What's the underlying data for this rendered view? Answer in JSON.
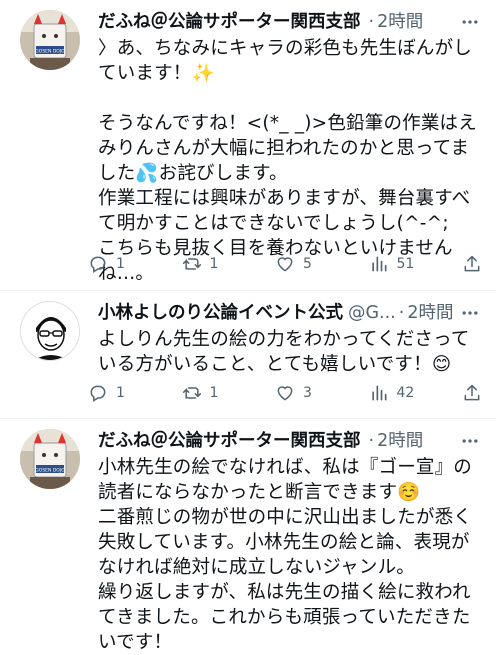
{
  "tweets": [
    {
      "name": "だふね＠公論サポーター関西支部",
      "handle": "",
      "dot": "·",
      "time": "2時間",
      "text": "〉あ、ちなみにキャラの彩色も先生ぼんがしています！✨\n\nそうなんですね！<(*_ _)>色鉛筆の作業はえみりんさんが大幅に担われたのかと思ってました💦お詫びします。\n作業工程には興味がありますが、舞台裏すべて明かすことはできないでしょうし(^-^;　こちらも見抜く目を養わないといけませんね…。",
      "actions": {
        "reply": "1",
        "retweet": "1",
        "like": "5",
        "views": "51"
      }
    },
    {
      "name": "小林よしのり公論イベント公式",
      "handle": "@G...",
      "dot": "·",
      "time": "2時間",
      "text": "よしりん先生の絵の力をわかってくださっている方がいること、とても嬉しいです！😊",
      "actions": {
        "reply": "1",
        "retweet": "1",
        "like": "3",
        "views": "42"
      }
    },
    {
      "name": "だふね＠公論サポーター関西支部",
      "handle": "",
      "dot": "·",
      "time": "2時間",
      "text": "小林先生の絵でなければ、私は『ゴー宣』の読者にならなかったと断言できます☺️\n二番煎じの物が世の中に沢山出ましたが悉く失敗しています。小林先生の絵と論、表現がなければ絶対に成立しないジャンル。\n繰り返しますが、私は先生の描く絵に救われてきました。これからも頑張っていただきたいです！"
    }
  ],
  "icons": {
    "reply": "reply-icon",
    "retweet": "retweet-icon",
    "like": "like-icon",
    "views": "views-icon",
    "share": "share-icon",
    "more": "more-icon"
  },
  "avatar_text": "GOSEN DOJO"
}
